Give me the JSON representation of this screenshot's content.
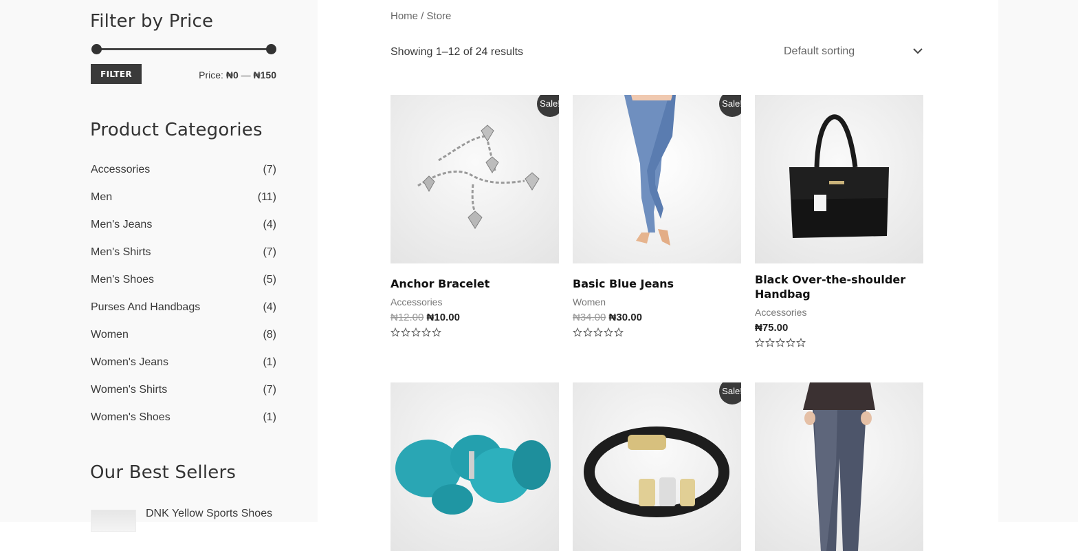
{
  "sidebar": {
    "price_filter": {
      "title": "Filter by Price",
      "button_label": "FILTER",
      "price_prefix": "Price:",
      "price_min": "₦0",
      "price_sep": "—",
      "price_max": "₦150"
    },
    "categories": {
      "title": "Product Categories",
      "items": [
        {
          "label": "Accessories",
          "count": "(7)"
        },
        {
          "label": "Men",
          "count": "(11)"
        },
        {
          "label": "Men's Jeans",
          "count": "(4)"
        },
        {
          "label": "Men's Shirts",
          "count": "(7)"
        },
        {
          "label": "Men's Shoes",
          "count": "(5)"
        },
        {
          "label": "Purses And Handbags",
          "count": "(4)"
        },
        {
          "label": "Women",
          "count": "(8)"
        },
        {
          "label": "Women's Jeans",
          "count": "(1)"
        },
        {
          "label": "Women's Shirts",
          "count": "(7)"
        },
        {
          "label": "Women's Shoes",
          "count": "(1)"
        }
      ]
    },
    "best_sellers": {
      "title": "Our Best Sellers",
      "items": [
        {
          "name": "DNK Yellow Sports Shoes"
        }
      ]
    }
  },
  "main": {
    "breadcrumb": {
      "home": "Home",
      "sep": "/",
      "current": "Store"
    },
    "result_count": "Showing 1–12 of 24 results",
    "sorting": {
      "selected": "Default sorting",
      "icon": "chevron-down-icon"
    },
    "sale_label": "Sale!",
    "products": [
      {
        "name": "Anchor Bracelet",
        "category": "Accessories",
        "old_price": "₦12.00",
        "price": "₦10.00",
        "sale": true,
        "rating": 0
      },
      {
        "name": "Basic Blue Jeans",
        "category": "Women",
        "old_price": "₦34.00",
        "price": "₦30.00",
        "sale": true,
        "rating": 0
      },
      {
        "name": "Black Over-the-shoulder Handbag",
        "category": "Accessories",
        "old_price": "",
        "price": "₦75.00",
        "sale": false,
        "rating": 0
      },
      {
        "name": "",
        "category": "",
        "old_price": "",
        "price": "",
        "sale": false,
        "rating": 0
      },
      {
        "name": "",
        "category": "",
        "old_price": "",
        "price": "",
        "sale": true,
        "rating": 0
      },
      {
        "name": "",
        "category": "",
        "old_price": "",
        "price": "",
        "sale": false,
        "rating": 0
      }
    ]
  },
  "colors": {
    "accent": "#3a3a3a",
    "sidebar_bg": "#f9f9f9"
  }
}
